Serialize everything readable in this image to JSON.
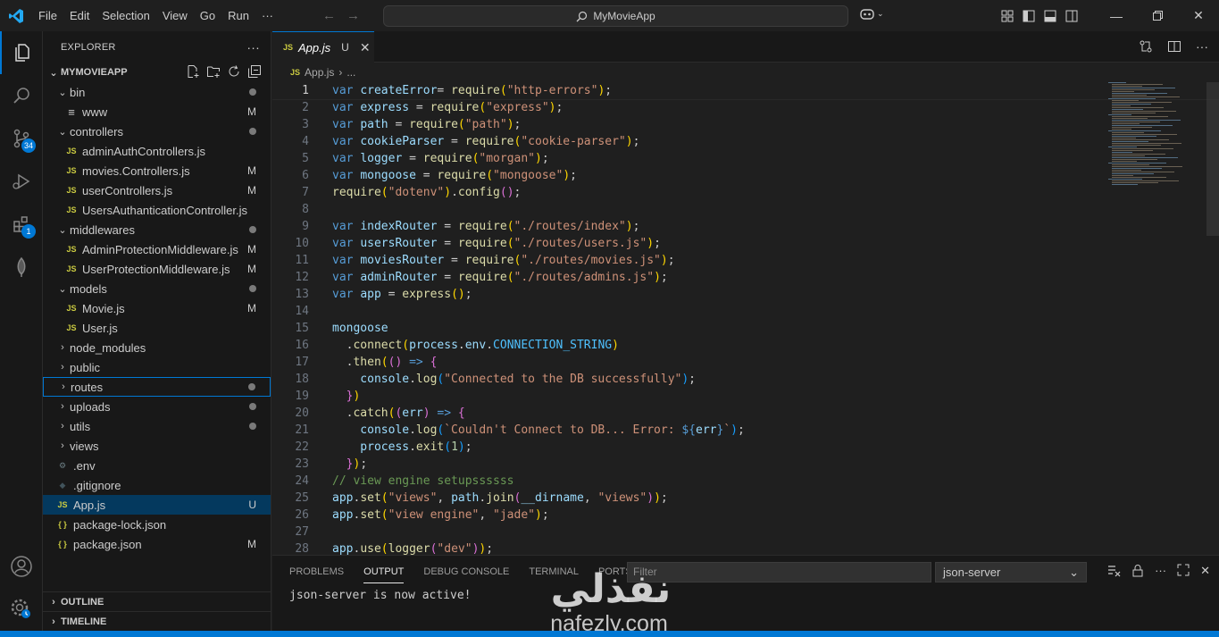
{
  "titlebar": {
    "menu": [
      "File",
      "Edit",
      "Selection",
      "View",
      "Go",
      "Run",
      "···"
    ],
    "search_text": "MyMovieApp"
  },
  "activity": {
    "scm_badge": "34",
    "extensions_badge": "1"
  },
  "explorer": {
    "title": "EXPLORER",
    "folder": "MYMOVIEAPP",
    "outline": "OUTLINE",
    "timeline": "TIMELINE",
    "items": [
      {
        "label": "bin",
        "type": "folder",
        "open": true,
        "depth": 0,
        "deco": "dot"
      },
      {
        "label": "www",
        "type": "file",
        "icon": "lines",
        "depth": 1,
        "deco": "M"
      },
      {
        "label": "controllers",
        "type": "folder",
        "open": true,
        "depth": 0,
        "deco": "dot"
      },
      {
        "label": "adminAuthControllers.js",
        "type": "js",
        "depth": 1,
        "deco": ""
      },
      {
        "label": "movies.Controllers.js",
        "type": "js",
        "depth": 1,
        "deco": "M"
      },
      {
        "label": "userControllers.js",
        "type": "js",
        "depth": 1,
        "deco": "M"
      },
      {
        "label": "UsersAuthanticationController.js",
        "type": "js",
        "depth": 1,
        "deco": ""
      },
      {
        "label": "middlewares",
        "type": "folder",
        "open": true,
        "depth": 0,
        "deco": "dot"
      },
      {
        "label": "AdminProtectionMiddleware.js",
        "type": "js",
        "depth": 1,
        "deco": "M"
      },
      {
        "label": "UserProtectionMiddleware.js",
        "type": "js",
        "depth": 1,
        "deco": "M"
      },
      {
        "label": "models",
        "type": "folder",
        "open": true,
        "depth": 0,
        "deco": "dot"
      },
      {
        "label": "Movie.js",
        "type": "js",
        "depth": 1,
        "deco": "M"
      },
      {
        "label": "User.js",
        "type": "js",
        "depth": 1,
        "deco": ""
      },
      {
        "label": "node_modules",
        "type": "folder",
        "open": false,
        "depth": 0,
        "deco": ""
      },
      {
        "label": "public",
        "type": "folder",
        "open": false,
        "depth": 0,
        "deco": ""
      },
      {
        "label": "routes",
        "type": "folder",
        "open": false,
        "depth": 0,
        "deco": "dot",
        "focused": true
      },
      {
        "label": "uploads",
        "type": "folder",
        "open": false,
        "depth": 0,
        "deco": "dot"
      },
      {
        "label": "utils",
        "type": "folder",
        "open": false,
        "depth": 0,
        "deco": "dot"
      },
      {
        "label": "views",
        "type": "folder",
        "open": false,
        "depth": 0,
        "deco": ""
      },
      {
        "label": ".env",
        "type": "gear",
        "depth": 0,
        "deco": ""
      },
      {
        "label": ".gitignore",
        "type": "git",
        "depth": 0,
        "deco": ""
      },
      {
        "label": "App.js",
        "type": "js",
        "depth": 0,
        "deco": "U",
        "selected": true
      },
      {
        "label": "package-lock.json",
        "type": "json",
        "depth": 0,
        "deco": ""
      },
      {
        "label": "package.json",
        "type": "json",
        "depth": 0,
        "deco": "M"
      }
    ]
  },
  "editor": {
    "tab_label": "App.js",
    "tab_status": "U",
    "breadcrumb_file": "App.js",
    "breadcrumb_rest": "...",
    "lines": [
      [
        [
          "kw",
          "var "
        ],
        [
          "var",
          "createError"
        ],
        [
          "",
          "="
        ],
        [
          "fn",
          " require"
        ],
        [
          "br1",
          "("
        ],
        [
          "str",
          "\"http-errors\""
        ],
        [
          "br1",
          ")"
        ],
        [
          "",
          ";"
        ]
      ],
      [
        [
          "kw",
          "var "
        ],
        [
          "var",
          "express"
        ],
        [
          "",
          " = "
        ],
        [
          "fn",
          "require"
        ],
        [
          "br1",
          "("
        ],
        [
          "str",
          "\"express\""
        ],
        [
          "br1",
          ")"
        ],
        [
          "",
          ";"
        ]
      ],
      [
        [
          "kw",
          "var "
        ],
        [
          "var",
          "path"
        ],
        [
          "",
          " = "
        ],
        [
          "fn",
          "require"
        ],
        [
          "br1",
          "("
        ],
        [
          "str",
          "\"path\""
        ],
        [
          "br1",
          ")"
        ],
        [
          "",
          ";"
        ]
      ],
      [
        [
          "kw",
          "var "
        ],
        [
          "var",
          "cookieParser"
        ],
        [
          "",
          " = "
        ],
        [
          "fn",
          "require"
        ],
        [
          "br1",
          "("
        ],
        [
          "str",
          "\"cookie-parser\""
        ],
        [
          "br1",
          ")"
        ],
        [
          "",
          ";"
        ]
      ],
      [
        [
          "kw",
          "var "
        ],
        [
          "var",
          "logger"
        ],
        [
          "",
          " = "
        ],
        [
          "fn",
          "require"
        ],
        [
          "br1",
          "("
        ],
        [
          "str",
          "\"morgan\""
        ],
        [
          "br1",
          ")"
        ],
        [
          "",
          ";"
        ]
      ],
      [
        [
          "kw",
          "var "
        ],
        [
          "var",
          "mongoose"
        ],
        [
          "",
          " = "
        ],
        [
          "fn",
          "require"
        ],
        [
          "br1",
          "("
        ],
        [
          "str",
          "\"mongoose\""
        ],
        [
          "br1",
          ")"
        ],
        [
          "",
          ";"
        ]
      ],
      [
        [
          "fn",
          "require"
        ],
        [
          "br1",
          "("
        ],
        [
          "str",
          "\"dotenv\""
        ],
        [
          "br1",
          ")"
        ],
        [
          "",
          "."
        ],
        [
          "fn",
          "config"
        ],
        [
          "br2",
          "()"
        ],
        [
          "",
          ";"
        ]
      ],
      [],
      [
        [
          "kw",
          "var "
        ],
        [
          "var",
          "indexRouter"
        ],
        [
          "",
          " = "
        ],
        [
          "fn",
          "require"
        ],
        [
          "br1",
          "("
        ],
        [
          "str",
          "\"./routes/index\""
        ],
        [
          "br1",
          ")"
        ],
        [
          "",
          ";"
        ]
      ],
      [
        [
          "kw",
          "var "
        ],
        [
          "var",
          "usersRouter"
        ],
        [
          "",
          " = "
        ],
        [
          "fn",
          "require"
        ],
        [
          "br1",
          "("
        ],
        [
          "str",
          "\"./routes/users.js\""
        ],
        [
          "br1",
          ")"
        ],
        [
          "",
          ";"
        ]
      ],
      [
        [
          "kw",
          "var "
        ],
        [
          "var",
          "moviesRouter"
        ],
        [
          "",
          " = "
        ],
        [
          "fn",
          "require"
        ],
        [
          "br1",
          "("
        ],
        [
          "str",
          "\"./routes/movies.js\""
        ],
        [
          "br1",
          ")"
        ],
        [
          "",
          ";"
        ]
      ],
      [
        [
          "kw",
          "var "
        ],
        [
          "var",
          "adminRouter"
        ],
        [
          "",
          " = "
        ],
        [
          "fn",
          "require"
        ],
        [
          "br1",
          "("
        ],
        [
          "str",
          "\"./routes/admins.js\""
        ],
        [
          "br1",
          ")"
        ],
        [
          "",
          ";"
        ]
      ],
      [
        [
          "kw",
          "var "
        ],
        [
          "var",
          "app"
        ],
        [
          "",
          " = "
        ],
        [
          "fn",
          "express"
        ],
        [
          "br1",
          "()"
        ],
        [
          "",
          ";"
        ]
      ],
      [],
      [
        [
          "var",
          "mongoose"
        ]
      ],
      [
        [
          "",
          "  ."
        ],
        [
          "fn",
          "connect"
        ],
        [
          "br1",
          "("
        ],
        [
          "var",
          "process"
        ],
        [
          "",
          "."
        ],
        [
          "var",
          "env"
        ],
        [
          "",
          "."
        ],
        [
          "cst",
          "CONNECTION_STRING"
        ],
        [
          "br1",
          ")"
        ]
      ],
      [
        [
          "",
          "  ."
        ],
        [
          "fn",
          "then"
        ],
        [
          "br1",
          "("
        ],
        [
          "br2",
          "()"
        ],
        [
          "kw",
          " => "
        ],
        [
          "br2",
          "{"
        ]
      ],
      [
        [
          "var",
          "    console"
        ],
        [
          "",
          "."
        ],
        [
          "fn",
          "log"
        ],
        [
          "br3",
          "("
        ],
        [
          "str",
          "\"Connected to the DB successfully\""
        ],
        [
          "br3",
          ")"
        ],
        [
          "",
          ";"
        ]
      ],
      [
        [
          "br2",
          "  }"
        ],
        [
          "br1",
          ")"
        ]
      ],
      [
        [
          "",
          "  ."
        ],
        [
          "fn",
          "catch"
        ],
        [
          "br1",
          "("
        ],
        [
          "br2",
          "("
        ],
        [
          "var",
          "err"
        ],
        [
          "br2",
          ")"
        ],
        [
          "kw",
          " => "
        ],
        [
          "br2",
          "{"
        ]
      ],
      [
        [
          "var",
          "    console"
        ],
        [
          "",
          "."
        ],
        [
          "fn",
          "log"
        ],
        [
          "br3",
          "("
        ],
        [
          "str",
          "`Couldn't Connect to DB... Error: "
        ],
        [
          "kw",
          "${"
        ],
        [
          "var",
          "err"
        ],
        [
          "kw",
          "}"
        ],
        [
          "str",
          "`"
        ],
        [
          "br3",
          ")"
        ],
        [
          "",
          ";"
        ]
      ],
      [
        [
          "var",
          "    process"
        ],
        [
          "",
          "."
        ],
        [
          "fn",
          "exit"
        ],
        [
          "br3",
          "("
        ],
        [
          "num",
          "1"
        ],
        [
          "br3",
          ")"
        ],
        [
          "",
          ";"
        ]
      ],
      [
        [
          "br2",
          "  }"
        ],
        [
          "br1",
          ")"
        ],
        [
          "",
          ";"
        ]
      ],
      [
        [
          "cm",
          "// view engine setupssssss"
        ]
      ],
      [
        [
          "var",
          "app"
        ],
        [
          "",
          "."
        ],
        [
          "fn",
          "set"
        ],
        [
          "br1",
          "("
        ],
        [
          "str",
          "\"views\""
        ],
        [
          "",
          ", "
        ],
        [
          "var",
          "path"
        ],
        [
          "",
          "."
        ],
        [
          "fn",
          "join"
        ],
        [
          "br2",
          "("
        ],
        [
          "var",
          "__dirname"
        ],
        [
          "",
          ", "
        ],
        [
          "str",
          "\"views\""
        ],
        [
          "br2",
          ")"
        ],
        [
          "br1",
          ")"
        ],
        [
          "",
          ";"
        ]
      ],
      [
        [
          "var",
          "app"
        ],
        [
          "",
          "."
        ],
        [
          "fn",
          "set"
        ],
        [
          "br1",
          "("
        ],
        [
          "str",
          "\"view engine\""
        ],
        [
          "",
          ", "
        ],
        [
          "str",
          "\"jade\""
        ],
        [
          "br1",
          ")"
        ],
        [
          "",
          ";"
        ]
      ],
      [],
      [
        [
          "var",
          "app"
        ],
        [
          "",
          "."
        ],
        [
          "fn",
          "use"
        ],
        [
          "br1",
          "("
        ],
        [
          "fn",
          "logger"
        ],
        [
          "br2",
          "("
        ],
        [
          "str",
          "\"dev\""
        ],
        [
          "br2",
          ")"
        ],
        [
          "br1",
          ")"
        ],
        [
          "",
          ";"
        ]
      ]
    ]
  },
  "panel": {
    "tabs": [
      "PROBLEMS",
      "OUTPUT",
      "DEBUG CONSOLE",
      "TERMINAL",
      "PORTS"
    ],
    "active_tab": "OUTPUT",
    "filter_placeholder": "Filter",
    "channel": "json-server",
    "output": "json-server is now active!"
  },
  "watermark": {
    "arabic": "نفذلي",
    "latin": "nafezly.com"
  }
}
